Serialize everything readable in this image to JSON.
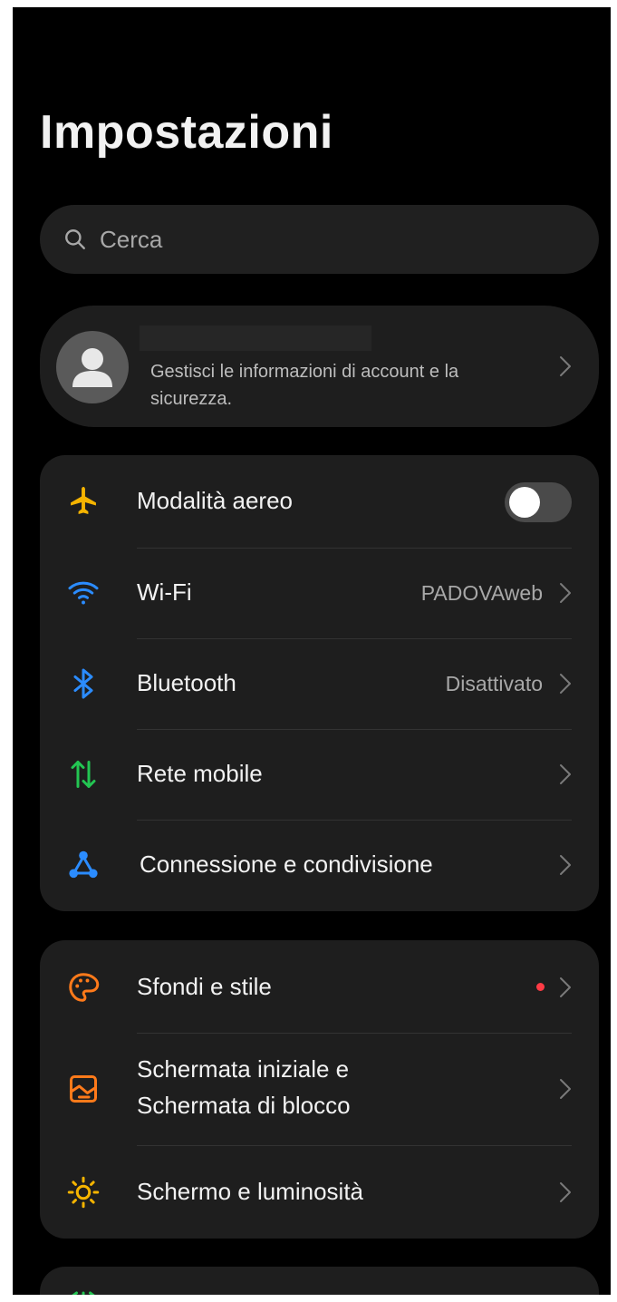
{
  "header": {
    "title": "Impostazioni"
  },
  "search": {
    "placeholder": "Cerca"
  },
  "account": {
    "description": "Gestisci le informazioni di account e la sicurezza."
  },
  "connectivity": {
    "airplane": {
      "label": "Modalità aereo",
      "icon": "airplane-icon",
      "color": "#f5b400",
      "enabled": false
    },
    "wifi": {
      "label": "Wi-Fi",
      "value": "PADOVAweb",
      "icon": "wifi-icon",
      "color": "#2b8cff"
    },
    "bluetooth": {
      "label": "Bluetooth",
      "value": "Disattivato",
      "icon": "bluetooth-icon",
      "color": "#2b8cff"
    },
    "mobile": {
      "label": "Rete mobile",
      "icon": "mobile-data-icon",
      "color": "#23c552"
    },
    "sharing": {
      "label": "Connessione e condivisione",
      "icon": "connection-sharing-icon",
      "color": "#2b8cff"
    }
  },
  "personalization": {
    "wallpaper": {
      "label": "Sfondi e stile",
      "icon": "palette-icon",
      "color": "#ff7a1a",
      "badge_color": "#ff3b45"
    },
    "home_lock": {
      "label_line1": "Schermata iniziale e",
      "label_line2": "Schermata di blocco",
      "icon": "home-lock-screen-icon",
      "color": "#ff7a1a"
    },
    "display": {
      "label": "Schermo e luminosità",
      "icon": "brightness-icon",
      "color": "#f5b400"
    }
  }
}
